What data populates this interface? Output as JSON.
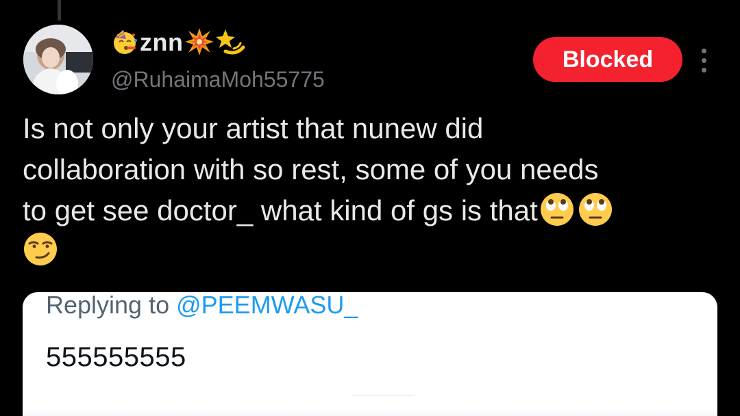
{
  "author": {
    "display_name": "znn",
    "name_emojis": [
      "party-face-emoji",
      "collision-emoji",
      "dizzy-emoji"
    ],
    "handle": "@RuhaimaMoh55775"
  },
  "actions": {
    "blocked_label": "Blocked"
  },
  "tweet": {
    "lines": [
      "Is not only your artist that nunew did",
      "collaboration with so rest, some of you needs",
      "to get see doctor_ what kind of gs is that"
    ],
    "trailing_emojis": [
      "🙄",
      "🙄"
    ],
    "last_line_emoji": "😏"
  },
  "quoted": {
    "replying_prefix": "Replying to ",
    "replying_mention": "@PEEMWASU_",
    "text": "555555555"
  },
  "colors": {
    "background": "#000000",
    "text": "#e7e9ea",
    "muted": "#71767b",
    "blocked": "#f4212e",
    "mention": "#1d9bf0"
  }
}
